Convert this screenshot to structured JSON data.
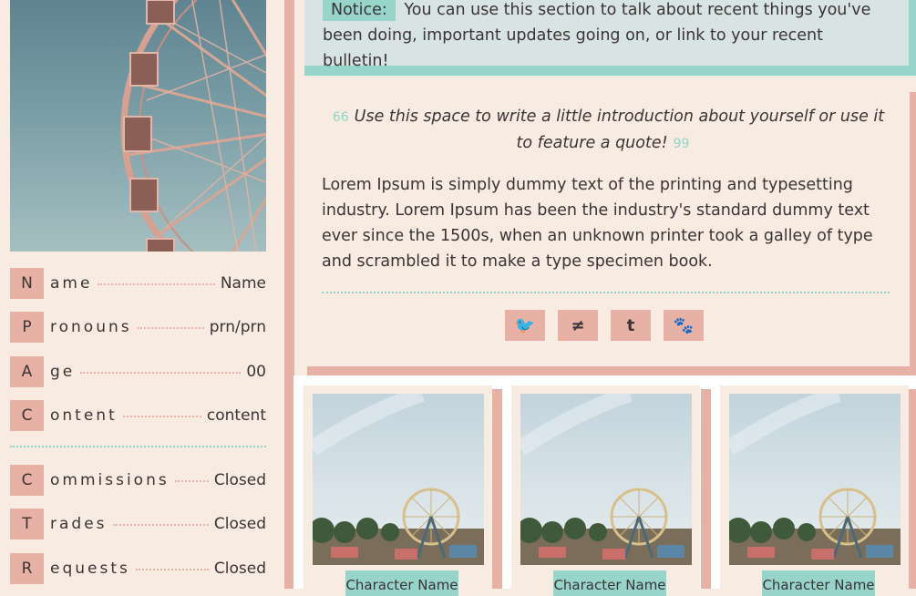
{
  "profile": {
    "rows": [
      {
        "letter": "N",
        "rest": "ame",
        "value": "Name"
      },
      {
        "letter": "P",
        "rest": "ronouns",
        "value": "prn/prn"
      },
      {
        "letter": "A",
        "rest": "ge",
        "value": "00"
      },
      {
        "letter": "C",
        "rest": "ontent",
        "value": "content"
      }
    ],
    "status_rows": [
      {
        "letter": "C",
        "rest": "ommissions",
        "value": "Closed"
      },
      {
        "letter": "T",
        "rest": "rades",
        "value": "Closed"
      },
      {
        "letter": "R",
        "rest": "equests",
        "value": "Closed"
      }
    ]
  },
  "notice": {
    "tag": "Notice:",
    "text": "You can use this section to talk about recent things you've been doing, important updates going on, or link to your recent bulletin!"
  },
  "intro": {
    "open_quote": "66",
    "quote": "Use this space to write a little introduction about yourself or use it to feature a quote!",
    "close_quote": "99",
    "body": "Lorem Ipsum is simply dummy text of the printing and typesetting industry. Lorem Ipsum has been the industry's standard dummy text ever since the 1500s, when an unknown printer took a galley of type and scrambled it to make a type specimen book."
  },
  "socials": [
    {
      "icon": "twitter-icon",
      "glyph": "🐦"
    },
    {
      "icon": "deviantart-icon",
      "glyph": "≠"
    },
    {
      "icon": "tumblr-icon",
      "glyph": "t"
    },
    {
      "icon": "paw-icon",
      "glyph": "🐾"
    }
  ],
  "characters": [
    {
      "name": "Character Name"
    },
    {
      "name": "Character Name"
    },
    {
      "name": "Character Name"
    }
  ],
  "colors": {
    "pink": "#e8b1a6",
    "teal": "#97d4c9",
    "cream": "#f8ece2",
    "notice_bg": "#d8e3e3"
  }
}
